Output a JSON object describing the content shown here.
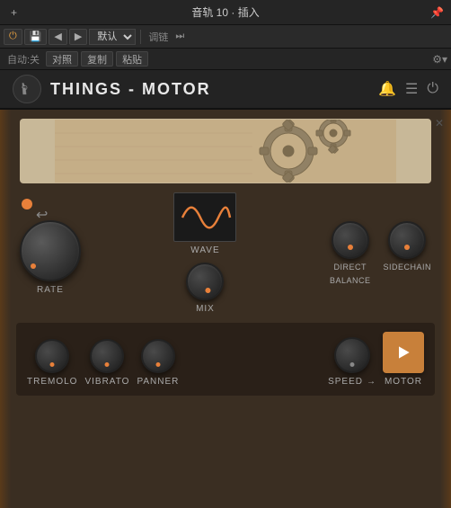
{
  "topbar": {
    "add_label": "+",
    "title": "音轨 10 · 插入",
    "pin_icon": "📌"
  },
  "toolbar": {
    "power_label": "⏻",
    "save_label": "💾",
    "prev_label": "◀",
    "next_label": "▶",
    "preset_label": "默认",
    "link_label": "调链",
    "link_icon": "⏭",
    "automate_label": "自动:关",
    "match_label": "对照",
    "copy_label": "复制",
    "paste_label": "粘贴",
    "gear_label": "⚙"
  },
  "plugin": {
    "title": "THINGS - MOTOR",
    "logo_symbol": "⚗",
    "rate_label": "RATE",
    "wave_label": "WAVE",
    "mix_label": "MIX",
    "direct_label": "DIRECT",
    "balance_label": "BALANCE",
    "sidechain_label": "SIDECHAIN",
    "tremolo_label": "TREMOLO",
    "vibrato_label": "VIBRATO",
    "panner_label": "PANNER",
    "speed_label": "SPEED",
    "motor_label": "MOTOR"
  }
}
